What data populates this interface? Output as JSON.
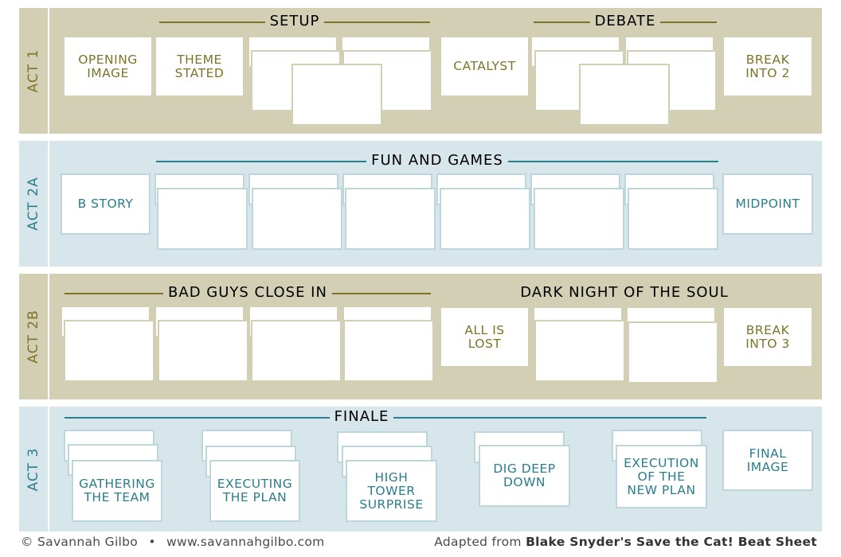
{
  "acts": [
    {
      "label": "ACT 1",
      "sections": [
        "SETUP",
        "DEBATE"
      ],
      "cards": [
        "OPENING\nIMAGE",
        "THEME\nSTATED",
        "CATALYST",
        "BREAK\nINTO 2"
      ]
    },
    {
      "label": "ACT 2A",
      "sections": [
        "FUN AND GAMES"
      ],
      "cards": [
        "B STORY",
        "MIDPOINT"
      ]
    },
    {
      "label": "ACT 2B",
      "sections": [
        "BAD GUYS CLOSE IN",
        "DARK NIGHT OF THE SOUL"
      ],
      "cards": [
        "ALL IS\nLOST",
        "BREAK\nINTO 3"
      ]
    },
    {
      "label": "ACT 3",
      "sections": [
        "FINALE"
      ],
      "cards": [
        "GATHERING\nTHE TEAM",
        "EXECUTING\nTHE PLAN",
        "HIGH\nTOWER\nSURPRISE",
        "DIG DEEP\nDOWN",
        "EXECUTION\nOF THE\nNEW PLAN",
        "FINAL\nIMAGE"
      ]
    }
  ],
  "footer": {
    "copyright": "© Savannah Gilbo",
    "separator": "•",
    "website": "www.savannahgilbo.com",
    "credit_prefix": "Adapted from",
    "credit_source": "Blake Snyder's Save the Cat! Beat Sheet"
  },
  "colors": {
    "tan": "#d3cfb4",
    "blue": "#d7e6ea",
    "tan_text": "#7d7429",
    "blue_text": "#2b7d8c"
  }
}
